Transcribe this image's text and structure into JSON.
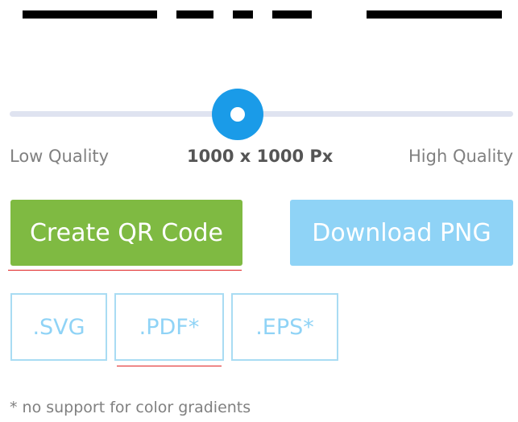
{
  "slider": {
    "low_label": "Low Quality",
    "high_label": "High Quality",
    "size_readout": "1000 x 1000 Px"
  },
  "actions": {
    "create_label": "Create QR Code",
    "download_label": "Download PNG"
  },
  "formats": [
    {
      "label": ".SVG"
    },
    {
      "label": ".PDF*"
    },
    {
      "label": ".EPS*"
    }
  ],
  "footnote": "* no support for color gradients",
  "colors": {
    "create_button": "#7fba42",
    "download_button": "#8fd3f6",
    "slider_thumb": "#1a9be8",
    "slider_track": "#dfe3f0",
    "format_border": "#a9dcf3"
  }
}
